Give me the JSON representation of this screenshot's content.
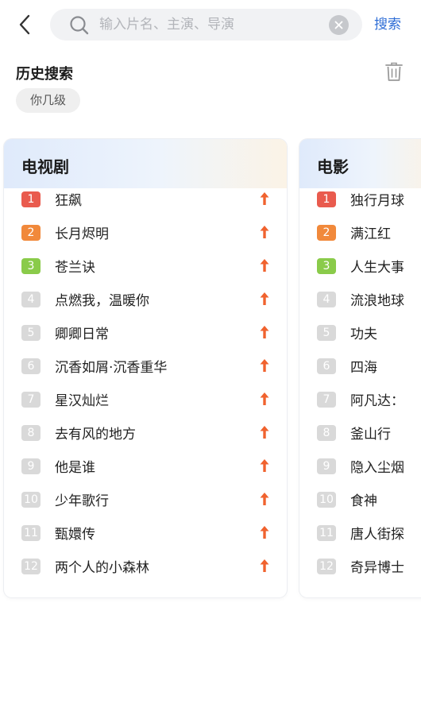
{
  "search": {
    "placeholder": "输入片名、主演、导演",
    "submit_label": "搜索"
  },
  "history": {
    "title": "历史搜索",
    "items": [
      "你几级"
    ]
  },
  "colors": {
    "accent": "#2f6ed6",
    "rank_1": "#e95b4e",
    "rank_2": "#f1893b",
    "rank_3": "#8acb4a",
    "rank_other": "#d9d9d9",
    "trend_up": "#f0622e"
  },
  "icons": {
    "back": "chevron-left-icon",
    "search": "search-icon",
    "clear": "close-circle-icon",
    "trash": "trash-icon",
    "trend": "arrow-up-icon"
  },
  "tv_list": {
    "title": "电视剧",
    "items": [
      {
        "rank": "1",
        "name": "狂飙"
      },
      {
        "rank": "2",
        "name": "长月烬明"
      },
      {
        "rank": "3",
        "name": "苍兰诀"
      },
      {
        "rank": "4",
        "name": "点燃我，温暖你"
      },
      {
        "rank": "5",
        "name": "卿卿日常"
      },
      {
        "rank": "6",
        "name": "沉香如屑·沉香重华"
      },
      {
        "rank": "7",
        "name": "星汉灿烂"
      },
      {
        "rank": "8",
        "name": "去有风的地方"
      },
      {
        "rank": "9",
        "name": "他是谁"
      },
      {
        "rank": "10",
        "name": "少年歌行"
      },
      {
        "rank": "11",
        "name": "甄嬛传"
      },
      {
        "rank": "12",
        "name": "两个人的小森林"
      }
    ]
  },
  "movie_list": {
    "title": "电影",
    "items": [
      {
        "rank": "1",
        "name": "独行月球"
      },
      {
        "rank": "2",
        "name": "满江红"
      },
      {
        "rank": "3",
        "name": "人生大事"
      },
      {
        "rank": "4",
        "name": "流浪地球"
      },
      {
        "rank": "5",
        "name": "功夫"
      },
      {
        "rank": "6",
        "name": "四海"
      },
      {
        "rank": "7",
        "name": "阿凡达："
      },
      {
        "rank": "8",
        "name": "釜山行"
      },
      {
        "rank": "9",
        "name": "隐入尘烟"
      },
      {
        "rank": "10",
        "name": "食神"
      },
      {
        "rank": "11",
        "name": "唐人街探"
      },
      {
        "rank": "12",
        "name": "奇异博士"
      }
    ]
  }
}
